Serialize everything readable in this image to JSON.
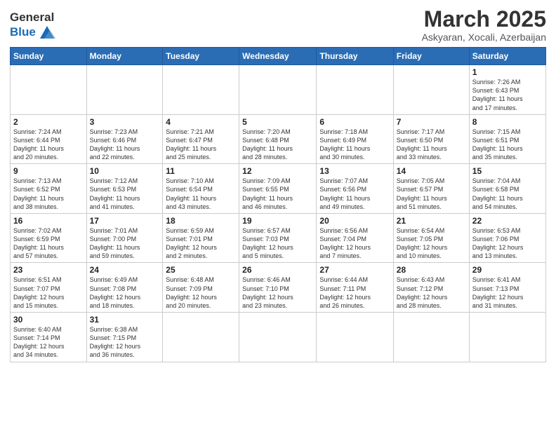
{
  "logo": {
    "text_general": "General",
    "text_blue": "Blue"
  },
  "header": {
    "month": "March 2025",
    "location": "Askyaran, Xocali, Azerbaijan"
  },
  "weekdays": [
    "Sunday",
    "Monday",
    "Tuesday",
    "Wednesday",
    "Thursday",
    "Friday",
    "Saturday"
  ],
  "weeks": [
    [
      {
        "day": "",
        "info": ""
      },
      {
        "day": "",
        "info": ""
      },
      {
        "day": "",
        "info": ""
      },
      {
        "day": "",
        "info": ""
      },
      {
        "day": "",
        "info": ""
      },
      {
        "day": "",
        "info": ""
      },
      {
        "day": "1",
        "info": "Sunrise: 7:26 AM\nSunset: 6:43 PM\nDaylight: 11 hours\nand 17 minutes."
      }
    ],
    [
      {
        "day": "2",
        "info": "Sunrise: 7:24 AM\nSunset: 6:44 PM\nDaylight: 11 hours\nand 20 minutes."
      },
      {
        "day": "3",
        "info": "Sunrise: 7:23 AM\nSunset: 6:46 PM\nDaylight: 11 hours\nand 22 minutes."
      },
      {
        "day": "4",
        "info": "Sunrise: 7:21 AM\nSunset: 6:47 PM\nDaylight: 11 hours\nand 25 minutes."
      },
      {
        "day": "5",
        "info": "Sunrise: 7:20 AM\nSunset: 6:48 PM\nDaylight: 11 hours\nand 28 minutes."
      },
      {
        "day": "6",
        "info": "Sunrise: 7:18 AM\nSunset: 6:49 PM\nDaylight: 11 hours\nand 30 minutes."
      },
      {
        "day": "7",
        "info": "Sunrise: 7:17 AM\nSunset: 6:50 PM\nDaylight: 11 hours\nand 33 minutes."
      },
      {
        "day": "8",
        "info": "Sunrise: 7:15 AM\nSunset: 6:51 PM\nDaylight: 11 hours\nand 35 minutes."
      }
    ],
    [
      {
        "day": "9",
        "info": "Sunrise: 7:13 AM\nSunset: 6:52 PM\nDaylight: 11 hours\nand 38 minutes."
      },
      {
        "day": "10",
        "info": "Sunrise: 7:12 AM\nSunset: 6:53 PM\nDaylight: 11 hours\nand 41 minutes."
      },
      {
        "day": "11",
        "info": "Sunrise: 7:10 AM\nSunset: 6:54 PM\nDaylight: 11 hours\nand 43 minutes."
      },
      {
        "day": "12",
        "info": "Sunrise: 7:09 AM\nSunset: 6:55 PM\nDaylight: 11 hours\nand 46 minutes."
      },
      {
        "day": "13",
        "info": "Sunrise: 7:07 AM\nSunset: 6:56 PM\nDaylight: 11 hours\nand 49 minutes."
      },
      {
        "day": "14",
        "info": "Sunrise: 7:05 AM\nSunset: 6:57 PM\nDaylight: 11 hours\nand 51 minutes."
      },
      {
        "day": "15",
        "info": "Sunrise: 7:04 AM\nSunset: 6:58 PM\nDaylight: 11 hours\nand 54 minutes."
      }
    ],
    [
      {
        "day": "16",
        "info": "Sunrise: 7:02 AM\nSunset: 6:59 PM\nDaylight: 11 hours\nand 57 minutes."
      },
      {
        "day": "17",
        "info": "Sunrise: 7:01 AM\nSunset: 7:00 PM\nDaylight: 11 hours\nand 59 minutes."
      },
      {
        "day": "18",
        "info": "Sunrise: 6:59 AM\nSunset: 7:01 PM\nDaylight: 12 hours\nand 2 minutes."
      },
      {
        "day": "19",
        "info": "Sunrise: 6:57 AM\nSunset: 7:03 PM\nDaylight: 12 hours\nand 5 minutes."
      },
      {
        "day": "20",
        "info": "Sunrise: 6:56 AM\nSunset: 7:04 PM\nDaylight: 12 hours\nand 7 minutes."
      },
      {
        "day": "21",
        "info": "Sunrise: 6:54 AM\nSunset: 7:05 PM\nDaylight: 12 hours\nand 10 minutes."
      },
      {
        "day": "22",
        "info": "Sunrise: 6:53 AM\nSunset: 7:06 PM\nDaylight: 12 hours\nand 13 minutes."
      }
    ],
    [
      {
        "day": "23",
        "info": "Sunrise: 6:51 AM\nSunset: 7:07 PM\nDaylight: 12 hours\nand 15 minutes."
      },
      {
        "day": "24",
        "info": "Sunrise: 6:49 AM\nSunset: 7:08 PM\nDaylight: 12 hours\nand 18 minutes."
      },
      {
        "day": "25",
        "info": "Sunrise: 6:48 AM\nSunset: 7:09 PM\nDaylight: 12 hours\nand 20 minutes."
      },
      {
        "day": "26",
        "info": "Sunrise: 6:46 AM\nSunset: 7:10 PM\nDaylight: 12 hours\nand 23 minutes."
      },
      {
        "day": "27",
        "info": "Sunrise: 6:44 AM\nSunset: 7:11 PM\nDaylight: 12 hours\nand 26 minutes."
      },
      {
        "day": "28",
        "info": "Sunrise: 6:43 AM\nSunset: 7:12 PM\nDaylight: 12 hours\nand 28 minutes."
      },
      {
        "day": "29",
        "info": "Sunrise: 6:41 AM\nSunset: 7:13 PM\nDaylight: 12 hours\nand 31 minutes."
      }
    ],
    [
      {
        "day": "30",
        "info": "Sunrise: 6:40 AM\nSunset: 7:14 PM\nDaylight: 12 hours\nand 34 minutes."
      },
      {
        "day": "31",
        "info": "Sunrise: 6:38 AM\nSunset: 7:15 PM\nDaylight: 12 hours\nand 36 minutes."
      },
      {
        "day": "",
        "info": ""
      },
      {
        "day": "",
        "info": ""
      },
      {
        "day": "",
        "info": ""
      },
      {
        "day": "",
        "info": ""
      },
      {
        "day": "",
        "info": ""
      }
    ]
  ]
}
